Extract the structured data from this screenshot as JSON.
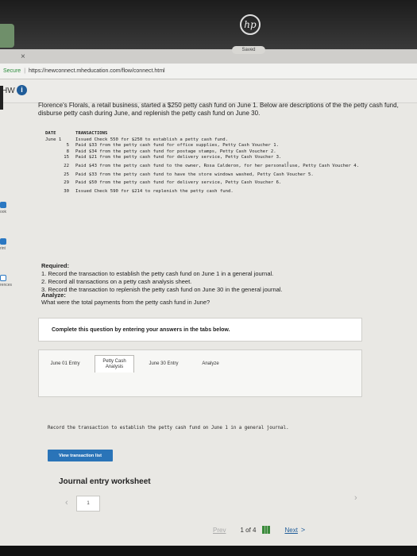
{
  "browser": {
    "tab_close": "×",
    "secure_label": "Secure",
    "url": "https://newconnect.mheducation.com/flow/connect.html"
  },
  "device": {
    "logo_text": "hp"
  },
  "header": {
    "hw_label": "HW",
    "info_icon": "i",
    "saved": "Saved"
  },
  "sidebar": {
    "items": [
      {
        "label": "ook"
      },
      {
        "label": "rint"
      },
      {
        "label": "rences"
      }
    ]
  },
  "question": {
    "intro": "Florence's Florals, a retail business, started a $250 petty cash fund on June 1. Below are descriptions of the the petty cash fund, disburse petty cash during June, and replenish the petty cash fund on June 30.",
    "table_head": {
      "date": "DATE",
      "transactions": "TRANSACTIONS"
    },
    "transactions": [
      {
        "date": "June 1",
        "text": "Issued Check 550 for $250 to establish a petty cash fund."
      },
      {
        "date": "5",
        "text": "Paid $33 from the petty cash fund for office supplies, Petty Cash Voucher 1."
      },
      {
        "date": "8",
        "text": "Paid $34 from the petty cash fund for postage stamps, Petty Cash Voucher 2."
      },
      {
        "date": "15",
        "text": "Paid $21 from the petty cash fund for delivery service, Petty Cash Voucher 3."
      },
      {
        "date": "22",
        "text": "Paid $43 from the petty cash fund to the owner, Rosa Calderon, for her personal use, Petty Cash Voucher 4."
      },
      {
        "date": "25",
        "text": "Paid $33 from the petty cash fund to have the store windows washed, Petty Cash Voucher 5."
      },
      {
        "date": "29",
        "text": "Paid $50 from the petty cash fund for delivery service, Petty Cash Voucher 6."
      },
      {
        "date": "30",
        "text": "Issued Check 590 for $214 to replenish the petty cash fund."
      }
    ],
    "required_title": "Required:",
    "required_items": [
      "1. Record the transaction to establish the petty cash fund on June 1 in a general journal.",
      "2. Record all transactions on a petty cash analysis sheet.",
      "3. Record the transaction to replenish the petty cash fund on June 30 in the general journal."
    ],
    "analyze_title": "Analyze:",
    "analyze_text": "What were the total payments from the petty cash fund in June?"
  },
  "answer_area": {
    "complete_prompt": "Complete this question by entering your answers in the tabs below.",
    "tabs": [
      {
        "label": "June 01 Entry",
        "active": false
      },
      {
        "label": "Petty Cash Analysis",
        "active": true
      },
      {
        "label": "June 30 Entry",
        "active": false
      },
      {
        "label": "Analyze",
        "active": false
      }
    ],
    "instruction": "Record the transaction to establish the petty cash fund on June 1 in a general journal.",
    "view_button": "View transaction list",
    "worksheet_title": "Journal entry worksheet",
    "pager_value": "1",
    "pager_prev": "‹",
    "pager_next": "›"
  },
  "footer": {
    "prev": "Prev",
    "page_count": "1 of 4",
    "next": "Next",
    "next_arrow": ">"
  },
  "colors": {
    "accent_blue": "#2a74b8",
    "info_blue": "#1f5c99",
    "secure_green": "#2a8a3a",
    "page_bg": "#e9e8e4"
  }
}
